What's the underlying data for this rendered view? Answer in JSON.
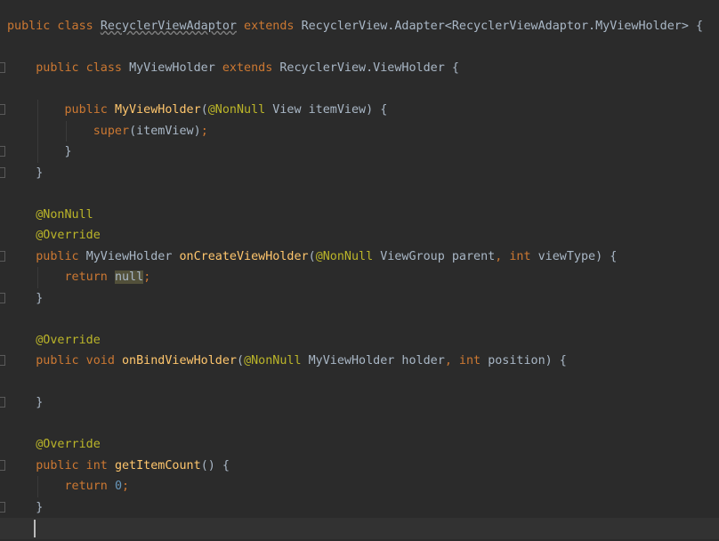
{
  "editor": {
    "lines": [
      [
        [
          "kw",
          "public class "
        ],
        [
          "warn",
          "RecyclerViewAdaptor"
        ],
        [
          "kw",
          " extends "
        ],
        [
          "pl",
          "RecyclerView.Adapter<RecyclerViewAdaptor.MyViewHolder> {"
        ]
      ],
      [],
      [
        [
          "pl",
          "    "
        ],
        [
          "kw",
          "public class "
        ],
        [
          "pl",
          "MyViewHolder "
        ],
        [
          "kw",
          "extends "
        ],
        [
          "pl",
          "RecyclerView.ViewHolder {"
        ]
      ],
      [],
      [
        [
          "pl",
          "        "
        ],
        [
          "kw",
          "public "
        ],
        [
          "fn",
          "MyViewHolder"
        ],
        [
          "pl",
          "("
        ],
        [
          "ann",
          "@NonNull"
        ],
        [
          "pl",
          " View itemView) {"
        ]
      ],
      [
        [
          "pl",
          "            "
        ],
        [
          "sup",
          "super"
        ],
        [
          "pl",
          "(itemView)"
        ],
        [
          "kw",
          ";"
        ]
      ],
      [
        [
          "pl",
          "        }"
        ]
      ],
      [
        [
          "pl",
          "    }"
        ]
      ],
      [],
      [
        [
          "pl",
          "    "
        ],
        [
          "ann",
          "@NonNull"
        ]
      ],
      [
        [
          "pl",
          "    "
        ],
        [
          "ann",
          "@Override"
        ]
      ],
      [
        [
          "pl",
          "    "
        ],
        [
          "kw",
          "public "
        ],
        [
          "pl",
          "MyViewHolder "
        ],
        [
          "fn",
          "onCreateViewHolder"
        ],
        [
          "pl",
          "("
        ],
        [
          "ann",
          "@NonNull"
        ],
        [
          "pl",
          " ViewGroup parent"
        ],
        [
          "kw",
          ", int "
        ],
        [
          "pl",
          "viewType) {"
        ]
      ],
      [
        [
          "pl",
          "        "
        ],
        [
          "kw",
          "return "
        ],
        [
          "nullhl",
          "null"
        ],
        [
          "kw",
          ";"
        ]
      ],
      [
        [
          "pl",
          "    }"
        ]
      ],
      [],
      [
        [
          "pl",
          "    "
        ],
        [
          "ann",
          "@Override"
        ]
      ],
      [
        [
          "pl",
          "    "
        ],
        [
          "kw",
          "public void "
        ],
        [
          "fn",
          "onBindViewHolder"
        ],
        [
          "pl",
          "("
        ],
        [
          "ann",
          "@NonNull"
        ],
        [
          "pl",
          " MyViewHolder holder"
        ],
        [
          "kw",
          ", int "
        ],
        [
          "pl",
          "position) {"
        ]
      ],
      [],
      [
        [
          "pl",
          "    }"
        ]
      ],
      [],
      [
        [
          "pl",
          "    "
        ],
        [
          "ann",
          "@Override"
        ]
      ],
      [
        [
          "pl",
          "    "
        ],
        [
          "kw",
          "public int "
        ],
        [
          "fn",
          "getItemCount"
        ],
        [
          "pl",
          "() {"
        ]
      ],
      [
        [
          "pl",
          "        "
        ],
        [
          "kw",
          "return "
        ],
        [
          "num",
          "0"
        ],
        [
          "kw",
          ";"
        ]
      ],
      [
        [
          "pl",
          "    }"
        ]
      ],
      []
    ],
    "fold_markers": [
      2,
      4,
      6,
      7,
      11,
      13,
      16,
      18,
      21,
      23
    ],
    "current_line": 24
  },
  "colors": {
    "background": "#2b2b2b",
    "keyword": "#cc7832",
    "annotation": "#bbb529",
    "method": "#ffc66d",
    "plain": "#a9b7c6",
    "number": "#6897bb"
  }
}
